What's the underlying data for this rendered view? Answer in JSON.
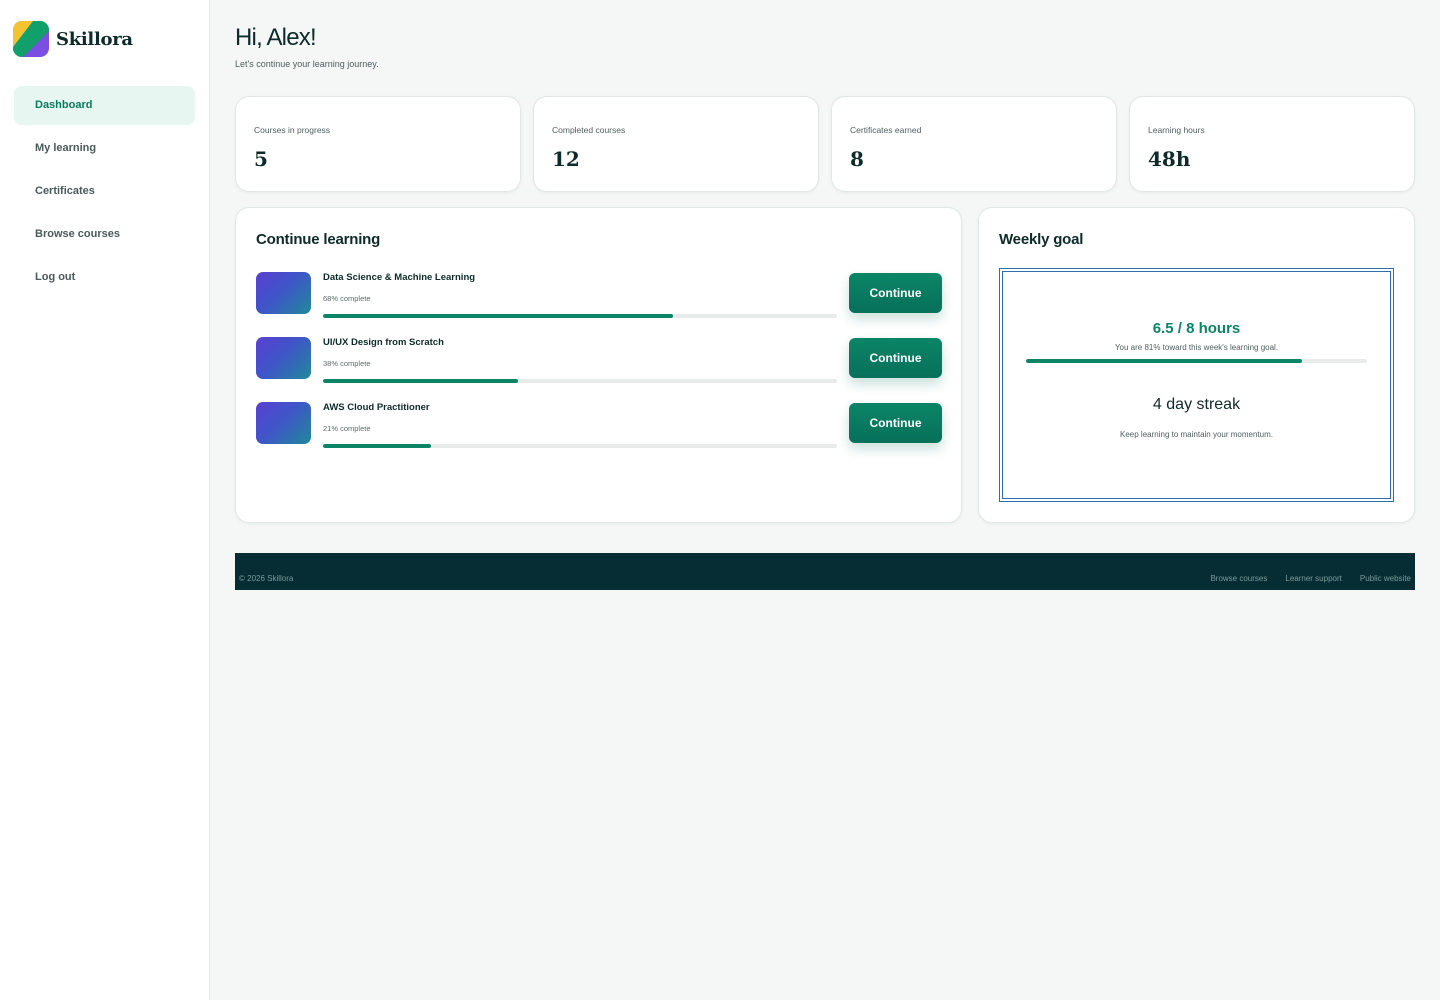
{
  "brand": {
    "name": "Skillora"
  },
  "nav": {
    "items": [
      {
        "label": "Dashboard",
        "active": true
      },
      {
        "label": "My learning"
      },
      {
        "label": "Certificates"
      },
      {
        "label": "Browse courses"
      },
      {
        "label": "Log out"
      }
    ]
  },
  "header": {
    "greeting": "Hi, Alex!",
    "subtitle": "Let's continue your learning journey."
  },
  "stats": [
    {
      "label": "Courses in progress",
      "value": "5"
    },
    {
      "label": "Completed courses",
      "value": "12"
    },
    {
      "label": "Certificates earned",
      "value": "8"
    },
    {
      "label": "Learning hours",
      "value": "48h"
    }
  ],
  "continue_learning": {
    "title": "Continue learning",
    "button_label": "Continue",
    "courses": [
      {
        "title": "Data Science & Machine Learning",
        "progress_label": "68% complete",
        "progress": 68
      },
      {
        "title": "UI/UX Design from Scratch",
        "progress_label": "38% complete",
        "progress": 38
      },
      {
        "title": "AWS Cloud Practitioner",
        "progress_label": "21% complete",
        "progress": 21
      }
    ]
  },
  "weekly_goal": {
    "title": "Weekly goal",
    "hours_text": "6.5 / 8 hours",
    "description": "You are 81% toward this week's learning goal.",
    "progress": 81,
    "streak_title": "4 day streak",
    "streak_description": "Keep learning to maintain your momentum."
  },
  "footer": {
    "copyright": "© 2026 Skillora",
    "links": [
      "Browse courses",
      "Learner support",
      "Public website"
    ]
  },
  "colors": {
    "accent": "#0b8566",
    "sidebar_active_bg": "#e7f6f0",
    "footer_bg": "#052d33",
    "goal_border": "#2c6fae"
  },
  "icons": {
    "logo": "skillora-logo-icon"
  }
}
